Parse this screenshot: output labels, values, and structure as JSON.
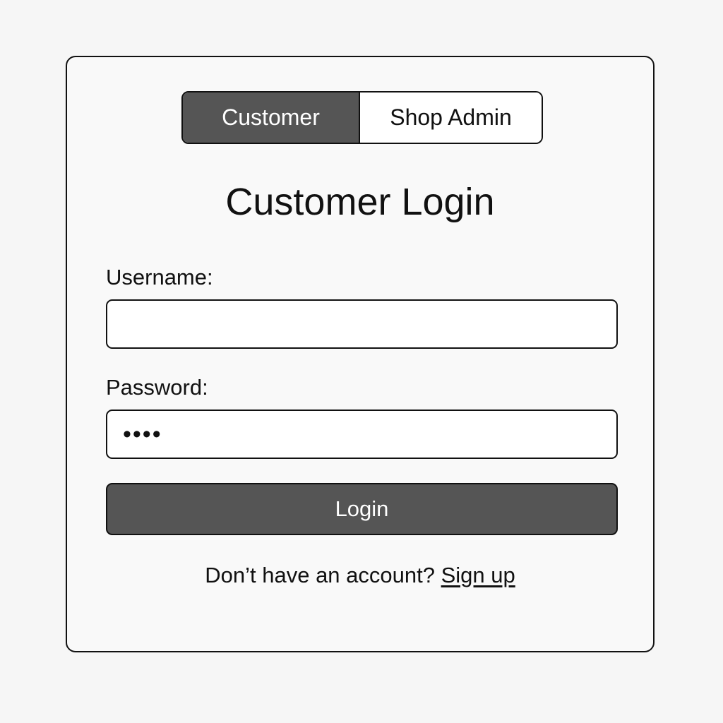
{
  "role_toggle": {
    "customer_label": "Customer",
    "admin_label": "Shop Admin",
    "selected": "Customer"
  },
  "login_form": {
    "title": "Customer Login",
    "username_label": "Username:",
    "username_value": "",
    "password_label": "Password:",
    "password_value": "••••",
    "submit_label": "Login"
  },
  "signup": {
    "prompt": "Don’t have an account?",
    "link_label": "Sign up"
  },
  "colors": {
    "background": "#f6f6f6",
    "border": "#111111",
    "active_fill": "#555555",
    "active_text": "#ffffff"
  }
}
